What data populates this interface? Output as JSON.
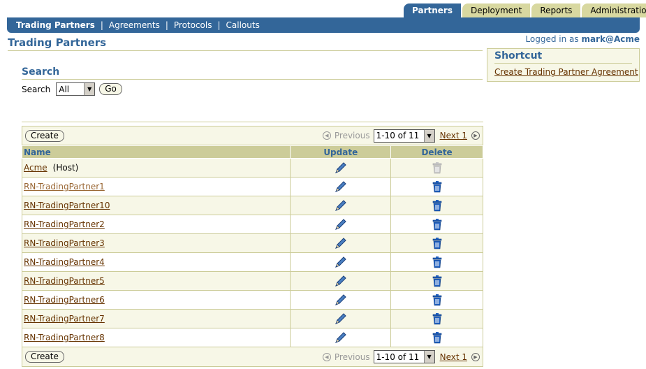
{
  "tabs": [
    {
      "label": "Partners",
      "active": true
    },
    {
      "label": "Deployment",
      "active": false
    },
    {
      "label": "Reports",
      "active": false
    },
    {
      "label": "Administration",
      "active": false
    }
  ],
  "subnav": [
    "Trading Partners",
    "Agreements",
    "Protocols",
    "Callouts"
  ],
  "user": {
    "prefix": "Logged in as",
    "name": "mark@Acme"
  },
  "page_title": "Trading Partners",
  "shortcut": {
    "title": "Shortcut",
    "link": "Create Trading Partner Agreement"
  },
  "search": {
    "heading": "Search",
    "label": "Search",
    "select_value": "All",
    "go_label": "Go"
  },
  "table": {
    "create_label": "Create",
    "previous_label": "Previous",
    "range": "1-10 of 11",
    "next_label": "Next 1",
    "columns": {
      "name": "Name",
      "update": "Update",
      "delete": "Delete"
    },
    "rows": [
      {
        "name": "Acme",
        "note": "(Host)",
        "delete_enabled": false
      },
      {
        "name": "RN-TradingPartner1",
        "note": "",
        "delete_enabled": true
      },
      {
        "name": "RN-TradingPartner10",
        "note": "",
        "delete_enabled": true
      },
      {
        "name": "RN-TradingPartner2",
        "note": "",
        "delete_enabled": true
      },
      {
        "name": "RN-TradingPartner3",
        "note": "",
        "delete_enabled": true
      },
      {
        "name": "RN-TradingPartner4",
        "note": "",
        "delete_enabled": true
      },
      {
        "name": "RN-TradingPartner5",
        "note": "",
        "delete_enabled": true
      },
      {
        "name": "RN-TradingPartner6",
        "note": "",
        "delete_enabled": true
      },
      {
        "name": "RN-TradingPartner7",
        "note": "",
        "delete_enabled": true
      },
      {
        "name": "RN-TradingPartner8",
        "note": "",
        "delete_enabled": true
      }
    ]
  },
  "colors": {
    "brand_blue": "#336699",
    "tan": "#cccc99",
    "link": "#663300"
  },
  "icons": {
    "update": "pencil-icon",
    "delete": "trash-icon",
    "previous": "previous-icon",
    "next": "next-icon"
  }
}
